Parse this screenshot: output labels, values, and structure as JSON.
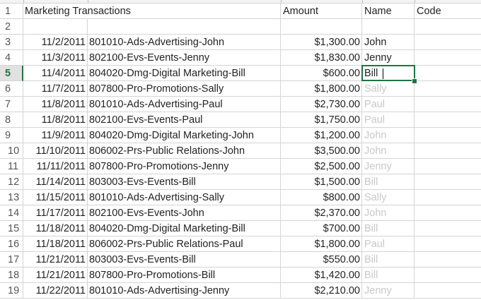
{
  "sheet": {
    "header_row": {
      "number": "1",
      "title": "Marketing Transactions",
      "amount_label": "Amount",
      "name_label": "Name",
      "code_label": "Code"
    },
    "empty_row_number": "2",
    "active_cell": {
      "row": "5",
      "value": "Bill"
    },
    "rows": [
      {
        "num": "3",
        "date": "11/2/2011",
        "desc": "801010-Ads-Advertising-John",
        "amount": "$1,300.00",
        "name": "John",
        "suggested": false
      },
      {
        "num": "4",
        "date": "11/3/2011",
        "desc": "802100-Evs-Events-Jenny",
        "amount": "$1,830.00",
        "name": "Jenny",
        "suggested": false
      },
      {
        "num": "5",
        "date": "11/4/2011",
        "desc": "804020-Dmg-Digital Marketing-Bill",
        "amount": "$600.00",
        "name": "Bill",
        "suggested": false
      },
      {
        "num": "6",
        "date": "11/7/2011",
        "desc": "807800-Pro-Promotions-Sally",
        "amount": "$1,800.00",
        "name": "Sally",
        "suggested": true
      },
      {
        "num": "7",
        "date": "11/8/2011",
        "desc": "801010-Ads-Advertising-Paul",
        "amount": "$2,730.00",
        "name": "Paul",
        "suggested": true
      },
      {
        "num": "8",
        "date": "11/8/2011",
        "desc": "802100-Evs-Events-Paul",
        "amount": "$1,750.00",
        "name": "Paul",
        "suggested": true
      },
      {
        "num": "9",
        "date": "11/9/2011",
        "desc": "804020-Dmg-Digital Marketing-John",
        "amount": "$1,200.00",
        "name": "John",
        "suggested": true
      },
      {
        "num": "10",
        "date": "11/10/2011",
        "desc": "806002-Prs-Public Relations-John",
        "amount": "$3,500.00",
        "name": "John",
        "suggested": true
      },
      {
        "num": "11",
        "date": "11/11/2011",
        "desc": "807800-Pro-Promotions-Jenny",
        "amount": "$2,500.00",
        "name": "Jenny",
        "suggested": true
      },
      {
        "num": "12",
        "date": "11/14/2011",
        "desc": "803003-Evs-Events-Bill",
        "amount": "$1,500.00",
        "name": "Bill",
        "suggested": true
      },
      {
        "num": "13",
        "date": "11/15/2011",
        "desc": "801010-Ads-Advertising-Sally",
        "amount": "$800.00",
        "name": "Sally",
        "suggested": true
      },
      {
        "num": "14",
        "date": "11/17/2011",
        "desc": "802100-Evs-Events-John",
        "amount": "$2,370.00",
        "name": "John",
        "suggested": true
      },
      {
        "num": "15",
        "date": "11/18/2011",
        "desc": "804020-Dmg-Digital Marketing-Bill",
        "amount": "$700.00",
        "name": "Bill",
        "suggested": true
      },
      {
        "num": "16",
        "date": "11/18/2011",
        "desc": "806002-Prs-Public Relations-Paul",
        "amount": "$1,800.00",
        "name": "Paul",
        "suggested": true
      },
      {
        "num": "17",
        "date": "11/21/2011",
        "desc": "803003-Evs-Events-Bill",
        "amount": "$550.00",
        "name": "Bill",
        "suggested": true
      },
      {
        "num": "18",
        "date": "11/21/2011",
        "desc": "807800-Pro-Promotions-Bill",
        "amount": "$1,420.00",
        "name": "Bill",
        "suggested": true
      },
      {
        "num": "19",
        "date": "11/22/2011",
        "desc": "801010-Ads-Advertising-Jenny",
        "amount": "$2,210.00",
        "name": "Jenny",
        "suggested": true
      }
    ]
  },
  "colors": {
    "accent": "#217346",
    "gridline": "#d4d4d4",
    "flash_fill_preview": "#c8c8c8"
  }
}
